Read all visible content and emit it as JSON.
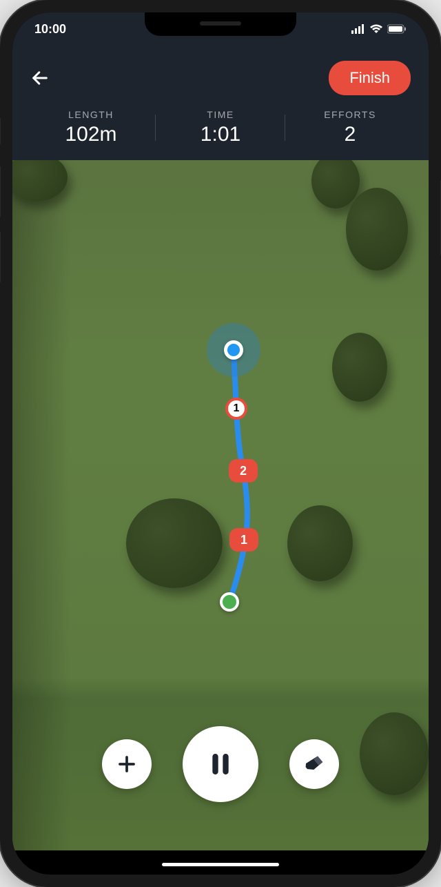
{
  "statusBar": {
    "time": "10:00"
  },
  "header": {
    "finishLabel": "Finish",
    "stats": {
      "lengthLabel": "LENGTH",
      "lengthValue": "102m",
      "timeLabel": "TIME",
      "timeValue": "1:01",
      "effortsLabel": "EFFORTS",
      "effortsValue": "2"
    }
  },
  "map": {
    "markers": {
      "m1": "1",
      "m2": "2",
      "m3": "1"
    }
  },
  "colors": {
    "accent": "#e84c3d",
    "location": "#2196f3",
    "endpoint": "#4caf50",
    "headerBg": "#1e242e"
  }
}
